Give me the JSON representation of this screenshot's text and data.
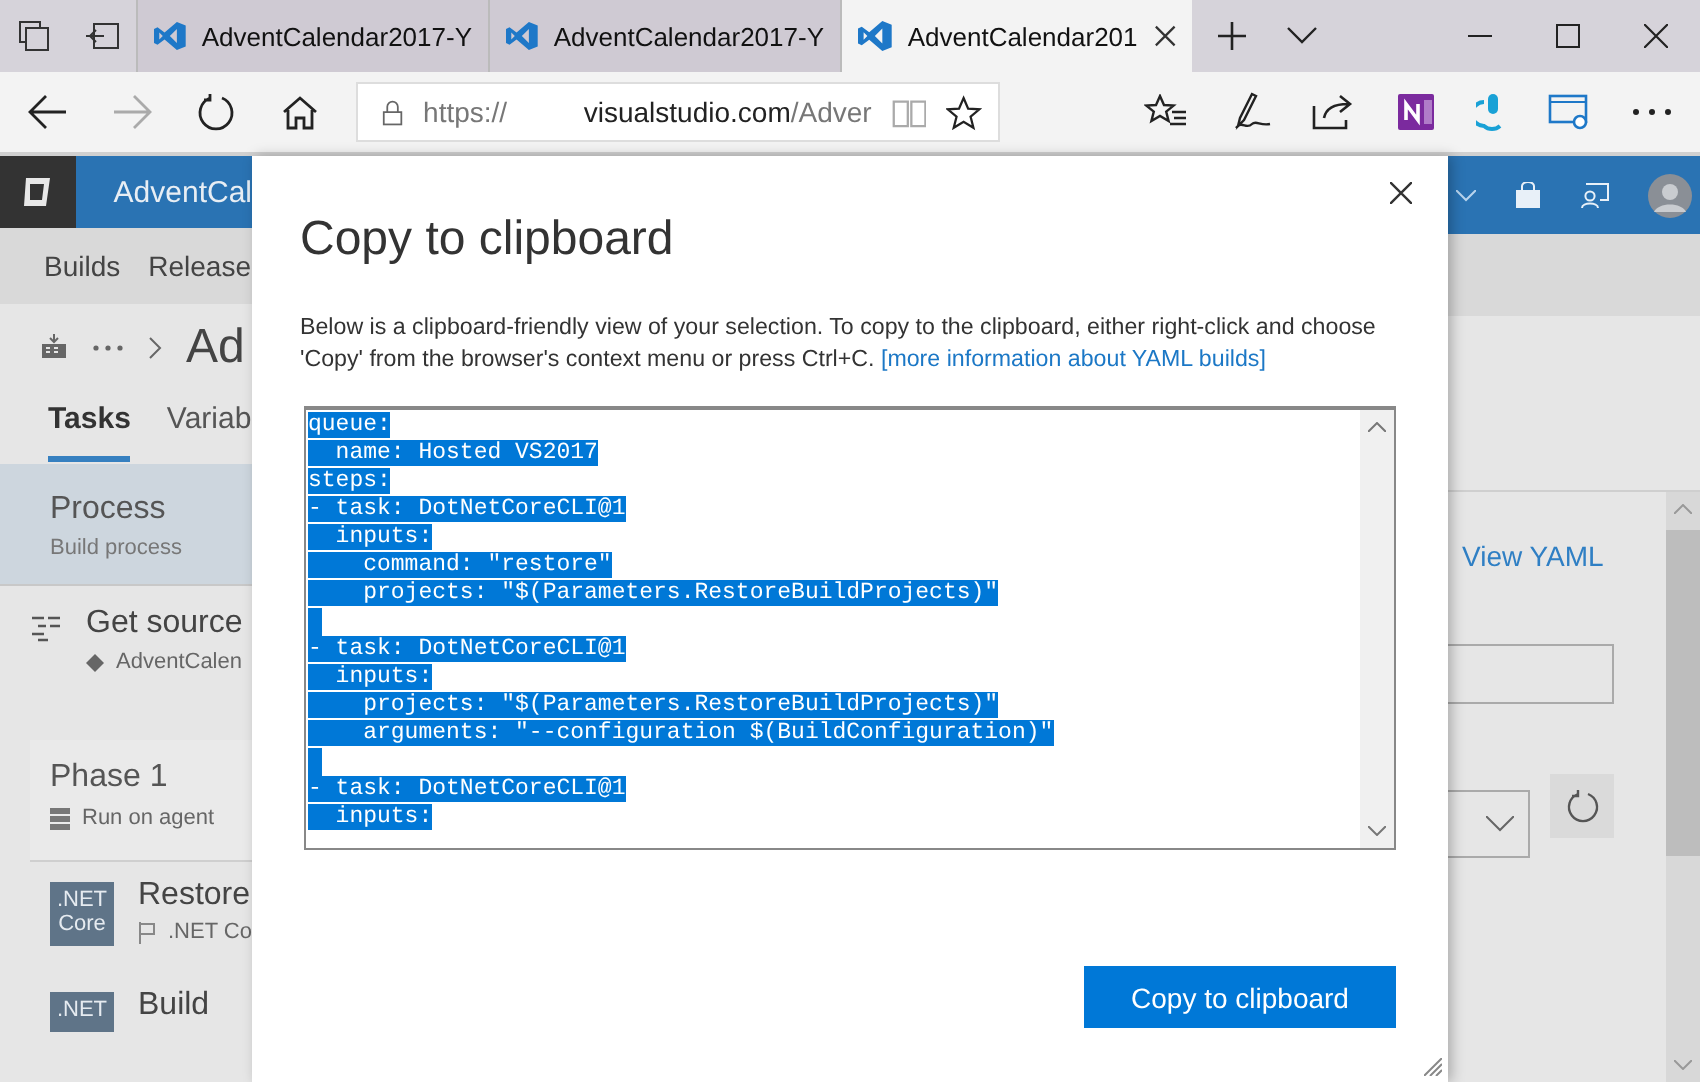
{
  "browser": {
    "tabs": [
      {
        "title": "AdventCalendar2017-Y",
        "selected": false
      },
      {
        "title": "AdventCalendar2017-Y",
        "selected": false
      },
      {
        "title": "AdventCalendar201",
        "selected": true
      }
    ],
    "forward_disabled": true,
    "url": {
      "scheme": "https://",
      "host": "visualstudio.com",
      "path": "/Adver"
    }
  },
  "page": {
    "project": "AdventCal",
    "nav": [
      "Builds",
      "Release"
    ],
    "title": "Ad",
    "tabs": [
      {
        "label": "Tasks",
        "selected": true
      },
      {
        "label": "Variab",
        "selected": false
      }
    ],
    "process": {
      "title": "Process",
      "subtitle": "Build process",
      "selected": true
    },
    "get_sources": {
      "title": "Get source",
      "repo": "AdventCalen"
    },
    "phase": {
      "title": "Phase 1",
      "subtitle": "Run on agent"
    },
    "tasks": [
      {
        "title": "Restore",
        "subtitle": ".NET Co",
        "icon_text": [
          ".NET",
          "Core"
        ]
      },
      {
        "title": "Build",
        "icon_text": [
          ".NET"
        ]
      }
    ],
    "view_yaml": "View YAML"
  },
  "dialog": {
    "title": "Copy to clipboard",
    "description": "Below is a clipboard-friendly view of your selection. To copy to the clipboard, either right-click and choose 'Copy' from the browser's context menu or press Ctrl+C.",
    "link": "[more information about YAML builds]",
    "code": {
      "selected": true,
      "lines": [
        {
          "kind": "text",
          "text": "queue:"
        },
        {
          "kind": "text",
          "text": "  name: Hosted VS2017"
        },
        {
          "kind": "text",
          "text": "steps:"
        },
        {
          "kind": "text",
          "text": "- task: DotNetCoreCLI@1"
        },
        {
          "kind": "text",
          "text": "  inputs:"
        },
        {
          "kind": "text",
          "text": "    command: \"restore\""
        },
        {
          "kind": "text",
          "text": "    projects: \"$(Parameters.RestoreBuildProjects)\""
        },
        {
          "kind": "blank"
        },
        {
          "kind": "text",
          "text": "- task: DotNetCoreCLI@1"
        },
        {
          "kind": "text",
          "text": "  inputs:"
        },
        {
          "kind": "text",
          "text": "    projects: \"$(Parameters.RestoreBuildProjects)\""
        },
        {
          "kind": "text",
          "text": "    arguments: \"--configuration $(BuildConfiguration)\""
        },
        {
          "kind": "blank"
        },
        {
          "kind": "text",
          "text": "- task: DotNetCoreCLI@1"
        },
        {
          "kind": "text",
          "text": "  inputs:"
        }
      ]
    },
    "button": "Copy to clipboard"
  }
}
